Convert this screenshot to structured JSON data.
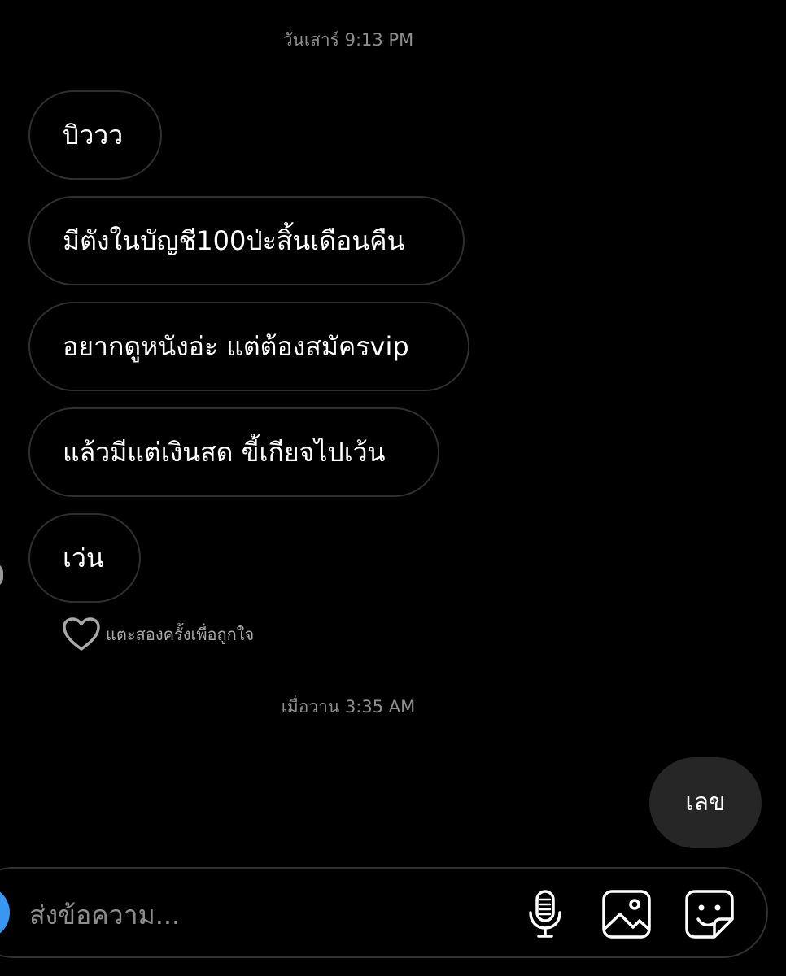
{
  "timestamps": {
    "first": "วันเสาร์ 9:13 PM",
    "second": "เมื่อวาน 3:35 AM"
  },
  "received_messages": [
    "บิววว",
    "มีตังในบัญชี100ป่ะสิ้นเดือนคืน",
    "อยากดูหนังอ่ะ แต่ต้องสมัครvip",
    "แล้วมีแต่เงินสด ขี้เกียจไปเว้น",
    "เว่น"
  ],
  "like_hint": {
    "icon": "heart-icon",
    "text": "แตะสองครั้งเพื่อถูกใจ"
  },
  "sent_messages": [
    "เลข"
  ],
  "composer": {
    "placeholder": "ส่งข้อความ...",
    "icons": [
      "camera-icon",
      "microphone-icon",
      "image-icon",
      "sticker-icon"
    ]
  },
  "colors": {
    "background": "#000000",
    "incoming_border": "#2f2f2f",
    "outgoing_bubble": "#262626",
    "muted_text": "#8e8e8e",
    "camera_button": "#3897f0"
  }
}
